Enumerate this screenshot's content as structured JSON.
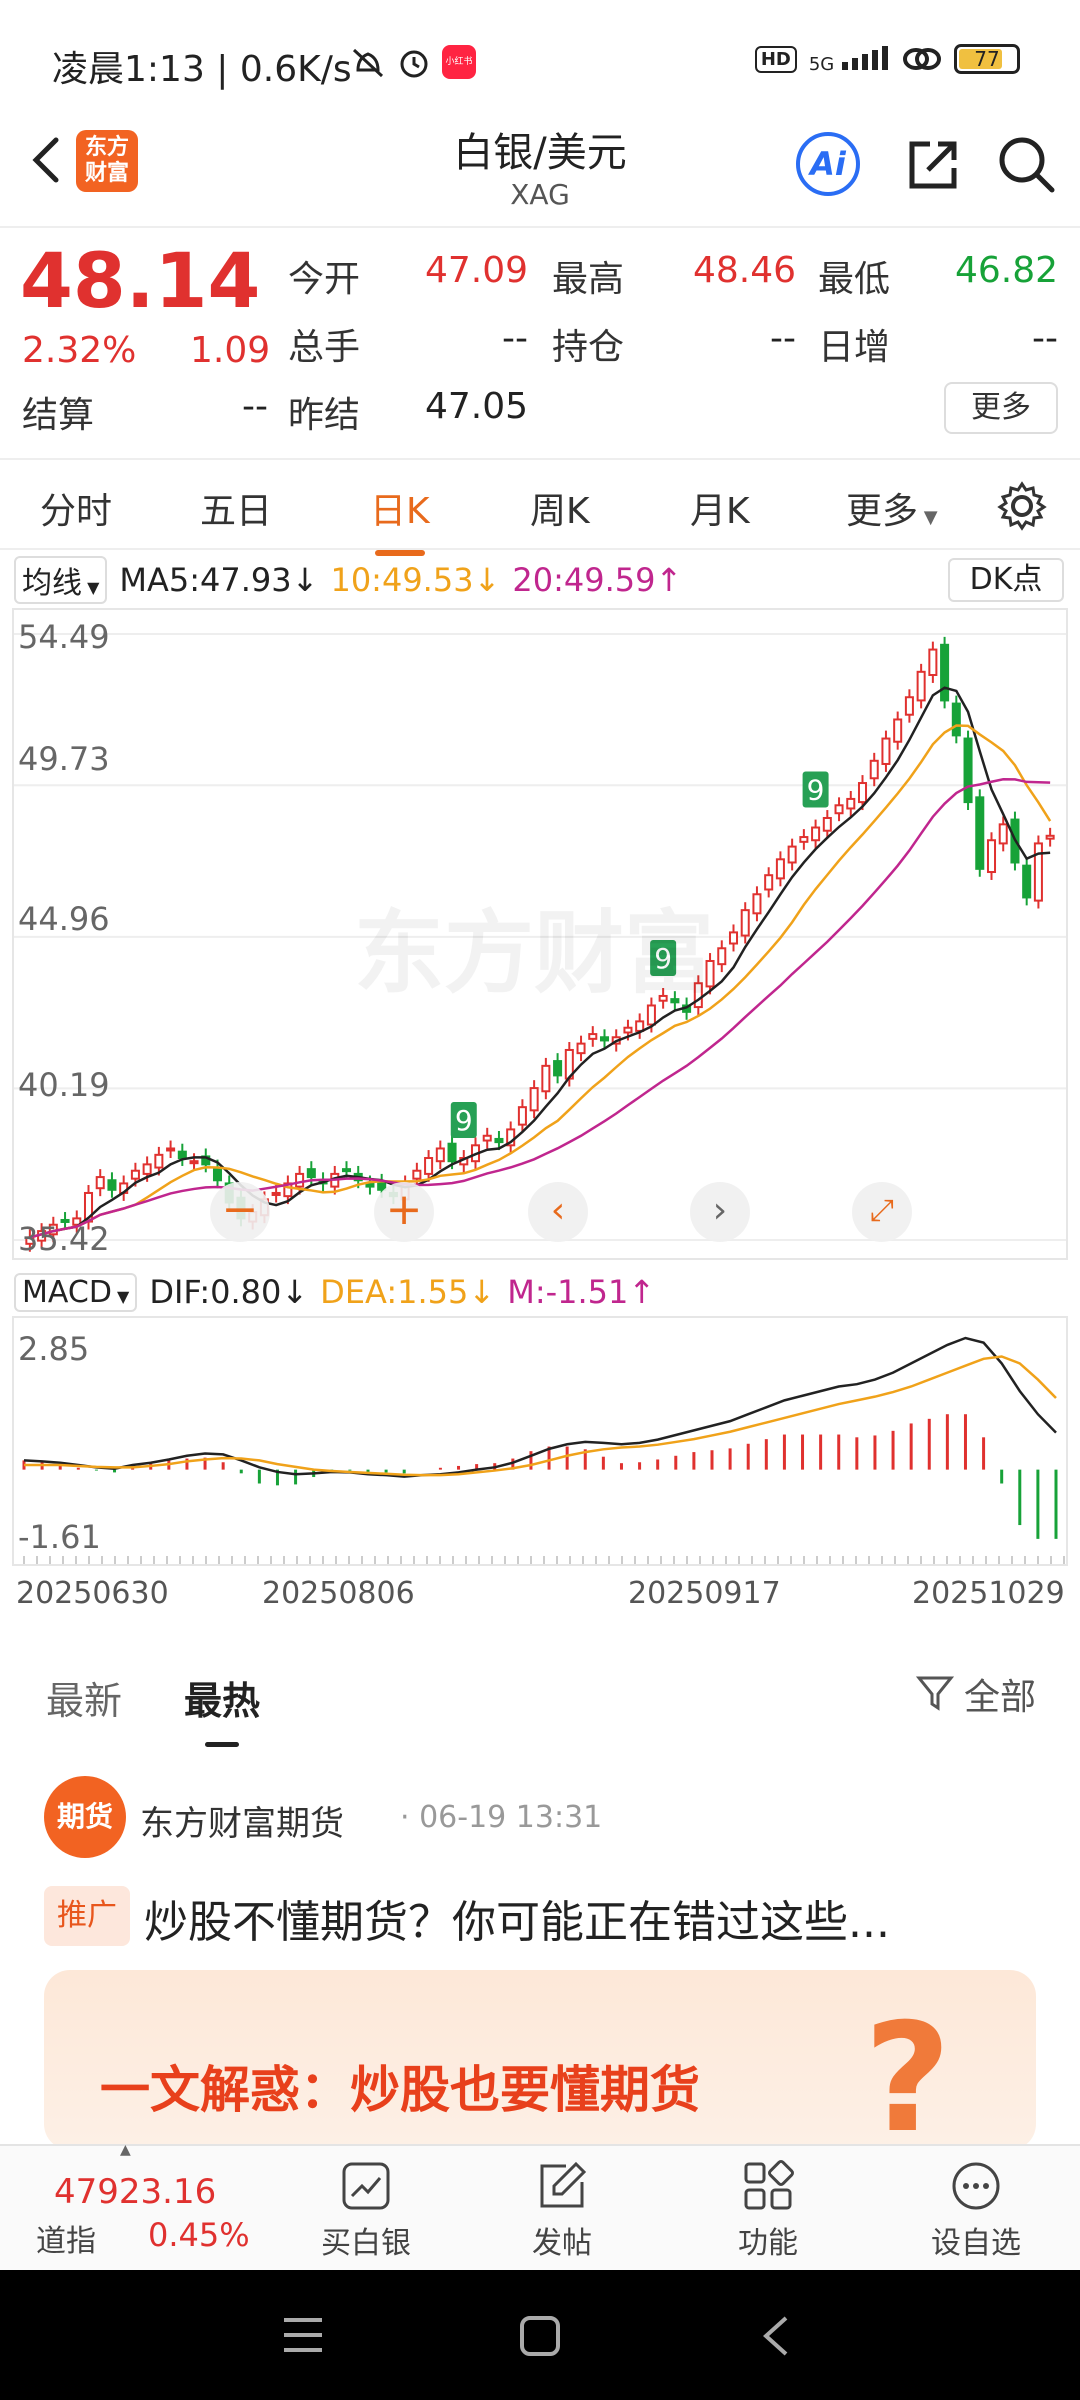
{
  "status_bar": {
    "time": "凌晨1:13 | 0.6K/s",
    "red_badge": "小红书",
    "network": "5G",
    "hd": "HD",
    "battery": "77"
  },
  "header": {
    "title": "白银/美元",
    "subtitle": "XAG",
    "logo_text": "东方财富",
    "ai_label": "Ai"
  },
  "quote": {
    "price": "48.14",
    "change_pct": "2.32%",
    "change": "1.09",
    "open_label": "今开",
    "open": "47.09",
    "high_label": "最高",
    "high": "48.46",
    "low_label": "最低",
    "low": "46.82",
    "volume_label": "总手",
    "volume": "--",
    "oi_label": "持仓",
    "oi": "--",
    "daily_inc_label": "日增",
    "daily_inc": "--",
    "settle_label": "结算",
    "settle": "--",
    "prev_settle_label": "昨结",
    "prev_settle": "47.05",
    "more_label": "更多"
  },
  "tabs": [
    "分时",
    "五日",
    "日K",
    "周K",
    "月K",
    "更多"
  ],
  "active_tab": "日K",
  "ma_row": {
    "select": "均线",
    "ma5": "MA5:47.93↓",
    "ma10": "10:49.53↓",
    "ma20": "20:49.59↑",
    "dk": "DK点"
  },
  "macd_row": {
    "select": "MACD",
    "dif": "DIF:0.80↓",
    "dea": "DEA:1.55↓",
    "m": "M:-1.51↑"
  },
  "watermark": "东方财富",
  "colors": {
    "up": "#e0312f",
    "down": "#17a238",
    "accent": "#e86a1c",
    "ma5": "#222222",
    "ma10": "#f0a21a",
    "ma20": "#c0268e"
  },
  "chart_data": [
    {
      "type": "candlestick",
      "y_ticks": [
        "54.49",
        "49.73",
        "44.96",
        "40.19",
        "35.42"
      ],
      "ylim": [
        35.42,
        54.49
      ],
      "grid": true,
      "close": [
        35.5,
        35.7,
        35.9,
        36.0,
        36.1,
        36.9,
        37.4,
        37.0,
        37.2,
        37.6,
        37.8,
        38.1,
        38.3,
        38.0,
        37.9,
        37.8,
        37.3,
        36.6,
        36.1,
        36.3,
        36.7,
        36.9,
        37.2,
        37.5,
        37.4,
        37.2,
        37.5,
        37.6,
        37.3,
        37.1,
        37.0,
        36.8,
        37.2,
        37.6,
        38.0,
        38.3,
        37.9,
        38.0,
        38.4,
        38.7,
        38.5,
        38.9,
        39.6,
        40.2,
        40.9,
        40.6,
        41.4,
        41.6,
        41.9,
        41.7,
        41.8,
        42.1,
        42.3,
        42.8,
        43.1,
        42.9,
        42.6,
        43.5,
        44.2,
        44.6,
        45.1,
        45.8,
        46.3,
        46.9,
        47.4,
        47.8,
        48.1,
        48.4,
        48.7,
        49.1,
        49.3,
        49.8,
        50.5,
        51.2,
        51.8,
        52.5,
        53.3,
        54.0,
        52.4,
        51.3,
        49.2,
        47.1,
        48.0,
        48.5,
        47.3,
        46.2,
        47.9,
        48.14
      ],
      "markers_tops": [
        {
          "label": "9",
          "index": 37
        },
        {
          "label": "9",
          "index": 54
        },
        {
          "label": "9",
          "index": 67
        }
      ]
    },
    {
      "type": "macd",
      "y_ticks": [
        "2.85",
        "-1.61"
      ],
      "series": [
        {
          "name": "DIF",
          "values": [
            0.2,
            0.18,
            0.15,
            0.1,
            0.05,
            0.02,
            0.1,
            0.15,
            0.22,
            0.3,
            0.35,
            0.33,
            0.2,
            0.05,
            -0.05,
            -0.1,
            -0.08,
            -0.05,
            -0.06,
            -0.1,
            -0.12,
            -0.15,
            -0.12,
            -0.1,
            -0.06,
            0.0,
            0.05,
            0.15,
            0.3,
            0.45,
            0.55,
            0.6,
            0.58,
            0.55,
            0.58,
            0.65,
            0.75,
            0.85,
            0.95,
            1.05,
            1.2,
            1.35,
            1.5,
            1.6,
            1.7,
            1.8,
            1.85,
            1.95,
            2.1,
            2.3,
            2.5,
            2.7,
            2.85,
            2.75,
            2.3,
            1.7,
            1.2,
            0.8
          ]
        },
        {
          "name": "DEA",
          "values": [
            0.1,
            0.1,
            0.1,
            0.08,
            0.06,
            0.05,
            0.05,
            0.08,
            0.12,
            0.18,
            0.22,
            0.25,
            0.24,
            0.2,
            0.12,
            0.06,
            0.0,
            -0.03,
            -0.05,
            -0.07,
            -0.09,
            -0.11,
            -0.12,
            -0.12,
            -0.1,
            -0.06,
            -0.02,
            0.03,
            0.1,
            0.2,
            0.3,
            0.38,
            0.44,
            0.48,
            0.5,
            0.54,
            0.6,
            0.66,
            0.74,
            0.82,
            0.92,
            1.02,
            1.12,
            1.22,
            1.32,
            1.42,
            1.5,
            1.58,
            1.68,
            1.8,
            1.95,
            2.1,
            2.25,
            2.4,
            2.45,
            2.3,
            1.95,
            1.55
          ]
        }
      ]
    }
  ],
  "x_axis_labels": [
    "20250630",
    "20250806",
    "20250917",
    "20251029"
  ],
  "news": {
    "tab_latest": "最新",
    "tab_hot": "最热",
    "filter": "全部",
    "author": "东方财富期货",
    "time": "· 06-19 13:31",
    "avatar_text": "期货",
    "tag": "推广",
    "title": "炒股不懂期货？你可能正在错过这些...",
    "banner_text": "一文解惑：炒股也要懂期货",
    "banner_mark": "?"
  },
  "bottom_bar": {
    "index_value": "47923.16",
    "index_name": "道指",
    "index_pct": "0.45%",
    "buy": "买白银",
    "post": "发帖",
    "func": "功能",
    "watch": "设自选"
  }
}
